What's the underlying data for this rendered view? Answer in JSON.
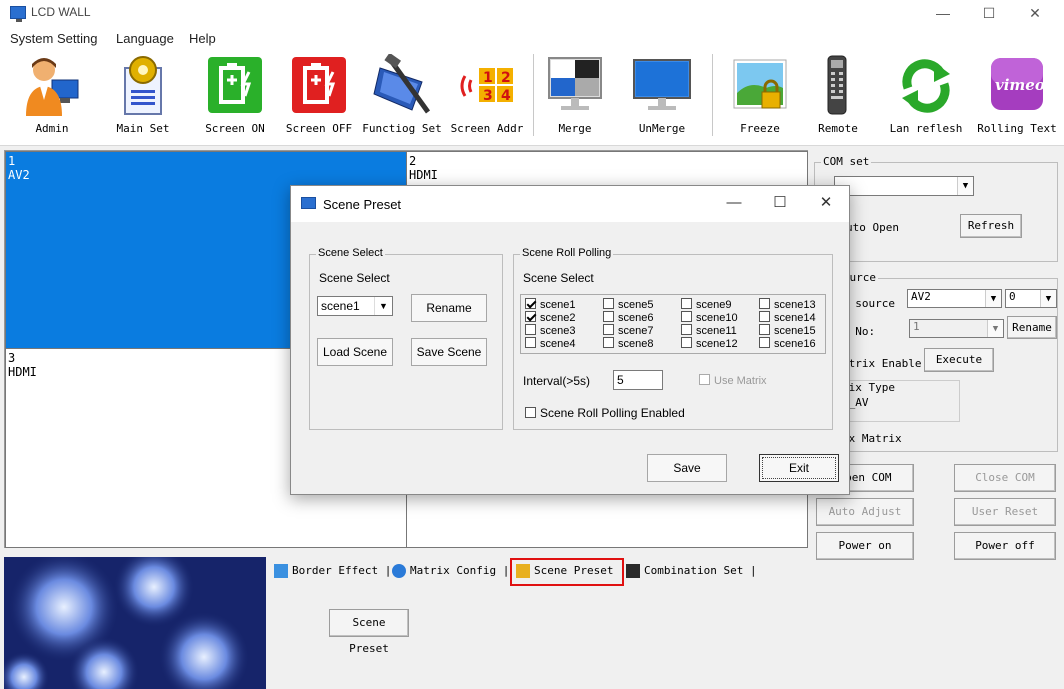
{
  "window": {
    "title": "LCD WALL"
  },
  "menu": [
    "System Setting",
    "Language",
    "Help"
  ],
  "toolbar": [
    {
      "label": "Admin",
      "icon": "admin-user-icon"
    },
    {
      "label": "Main Set",
      "icon": "main-set-gear-doc-icon"
    },
    {
      "label": "Screen ON",
      "icon": "screen-on-battery-icon"
    },
    {
      "label": "Screen OFF",
      "icon": "screen-off-battery-icon"
    },
    {
      "label": "Functiog Set",
      "icon": "function-set-tool-icon"
    },
    {
      "label": "Screen Addr",
      "icon": "screen-addr-numbers-icon"
    },
    {
      "label": "Merge",
      "icon": "merge-monitor-icon"
    },
    {
      "label": "UnMerge",
      "icon": "unmerge-monitor-icon"
    },
    {
      "label": "Freeze",
      "icon": "freeze-lock-image-icon"
    },
    {
      "label": "Remote",
      "icon": "remote-control-icon"
    },
    {
      "label": "Lan reflesh",
      "icon": "lan-refresh-arrows-icon"
    },
    {
      "label": "Rolling Text",
      "icon": "vimeo-rolling-text-icon"
    }
  ],
  "screens": [
    {
      "num": "1",
      "source": "AV2"
    },
    {
      "num": "2",
      "source": "HDMI"
    },
    {
      "num": "3",
      "source": "HDMI"
    }
  ],
  "right_panel": {
    "com_set_caption": "COM set",
    "auto_open": "uto Open",
    "refresh": "Refresh",
    "source_group_caption": ": source",
    "source_label": ": source",
    "source_value": "AV2",
    "source_num": "0",
    "no_label": ": No:",
    "no_value": "1",
    "rename": "Rename",
    "matrix_enable": "atrix Enable",
    "execute": "Execute",
    "matrix_type_label": "rix Type",
    "matrix_type_value": "5_AV",
    "matrix_label": ".x Matrix",
    "open_com": "Open COM",
    "close_com": "Close COM",
    "auto_adjust": "Auto Adjust",
    "user_reset": "User Reset",
    "power_on": "Power on",
    "power_off": "Power off"
  },
  "tabs": [
    {
      "label": "Border Effect",
      "icon": "border-effect-icon"
    },
    {
      "label": "Matrix Config",
      "icon": "matrix-config-icon"
    },
    {
      "label": "Scene Preset",
      "icon": "scene-preset-icon"
    },
    {
      "label": "Combination Set",
      "icon": "combination-set-icon"
    }
  ],
  "bottom": {
    "scene_preset_button": "Scene Preset"
  },
  "dialog": {
    "title": "Scene Preset",
    "scene_select_group": "Scene Select",
    "scene_select_label": "Scene Select",
    "scene_value": "scene1",
    "rename": "Rename",
    "load_scene": "Load Scene",
    "save_scene": "Save Scene",
    "roll_group": "Scene Roll Polling",
    "roll_scene_select": "Scene Select",
    "scenes": [
      {
        "label": "scene1",
        "checked": true
      },
      {
        "label": "scene2",
        "checked": true
      },
      {
        "label": "scene3",
        "checked": false
      },
      {
        "label": "scene4",
        "checked": false
      },
      {
        "label": "scene5",
        "checked": false
      },
      {
        "label": "scene6",
        "checked": false
      },
      {
        "label": "scene7",
        "checked": false
      },
      {
        "label": "scene8",
        "checked": false
      },
      {
        "label": "scene9",
        "checked": false
      },
      {
        "label": "scene10",
        "checked": false
      },
      {
        "label": "scene11",
        "checked": false
      },
      {
        "label": "scene12",
        "checked": false
      },
      {
        "label": "scene13",
        "checked": false
      },
      {
        "label": "scene14",
        "checked": false
      },
      {
        "label": "scene15",
        "checked": false
      },
      {
        "label": "scene16",
        "checked": false
      }
    ],
    "interval_label": "Interval(>5s)",
    "interval_value": "5",
    "use_matrix": "Use Matrix",
    "roll_enabled": "Scene Roll Polling Enabled",
    "save": "Save",
    "exit": "Exit"
  },
  "colors": {
    "selected_screen": "#0a7ce0",
    "tab_highlight": "#e01010"
  }
}
